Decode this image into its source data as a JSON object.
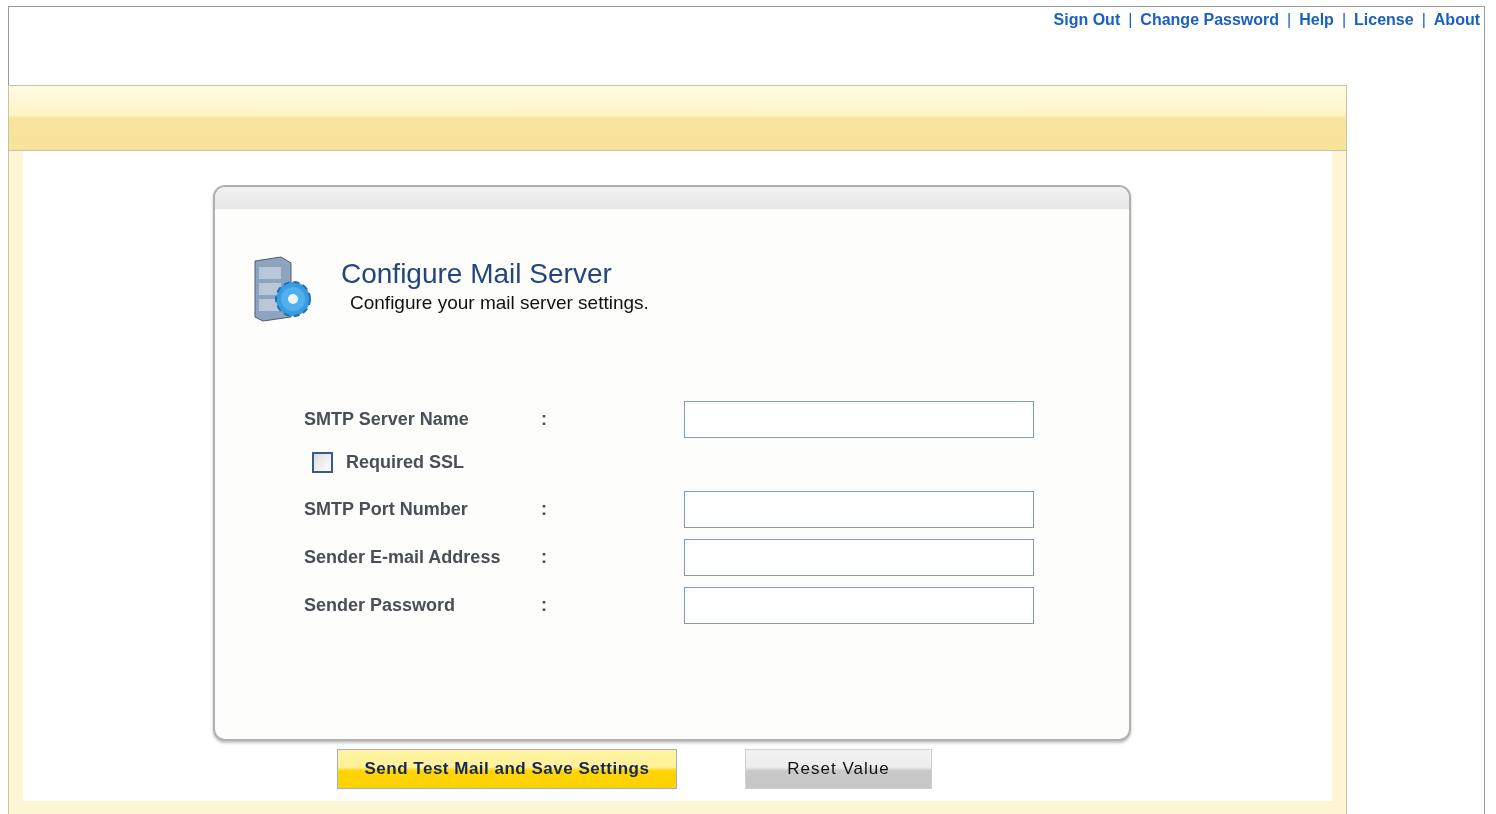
{
  "top_links": [
    {
      "kind": "link",
      "label": "Sign Out"
    },
    {
      "kind": "separator",
      "label": "|"
    },
    {
      "kind": "link",
      "label": "Change Password"
    },
    {
      "kind": "separator",
      "label": "|"
    },
    {
      "kind": "link",
      "label": "Help"
    },
    {
      "kind": "separator",
      "label": "|"
    },
    {
      "kind": "link",
      "label": "License"
    },
    {
      "kind": "separator",
      "label": "|"
    },
    {
      "kind": "link",
      "label": "About"
    }
  ],
  "card": {
    "title": "Configure Mail Server",
    "subtitle": "Configure your mail server settings."
  },
  "form_rows": [
    {
      "kind": "field",
      "label": "SMTP Server Name",
      "colon": ":"
    },
    {
      "kind": "checkbox",
      "label": "Required SSL",
      "checked": false
    },
    {
      "kind": "field",
      "label": "SMTP Port Number",
      "colon": ":"
    },
    {
      "kind": "field",
      "label": "Sender E-mail Address",
      "colon": ":"
    },
    {
      "kind": "field",
      "label": "Sender Password",
      "colon": ":"
    }
  ],
  "buttons": [
    {
      "kind": "primary",
      "label": "Send Test Mail and Save Settings"
    },
    {
      "kind": "secondary",
      "label": "Reset Value"
    }
  ]
}
